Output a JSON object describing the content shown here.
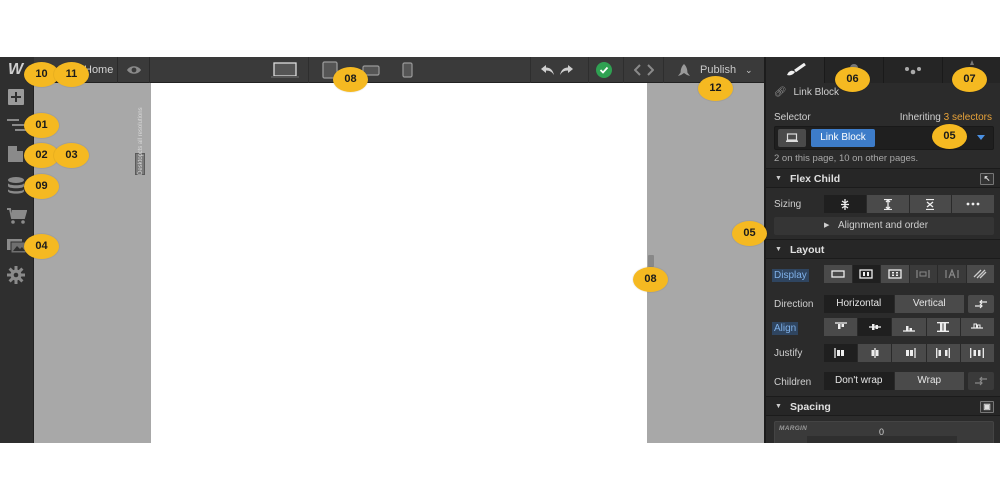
{
  "topbar": {
    "logo": "W",
    "page_name": "Home",
    "devices": [
      "desktop",
      "tablet",
      "mobile-landscape",
      "mobile-portrait"
    ],
    "active_device": "desktop",
    "publish_label": "Publish",
    "publish_chevron": "⌄"
  },
  "left_sidebar": {
    "items": [
      {
        "name": "add-elements",
        "icon": "plus-icon"
      },
      {
        "name": "navigator",
        "icon": "navigator-icon"
      },
      {
        "name": "pages",
        "icon": "pages-icon"
      },
      {
        "name": "cms",
        "icon": "database-icon"
      },
      {
        "name": "ecommerce",
        "icon": "cart-icon"
      },
      {
        "name": "assets",
        "icon": "images-icon"
      },
      {
        "name": "settings",
        "icon": "gear-icon"
      }
    ]
  },
  "canvas": {
    "breakpoint_note": "Affects all resolutions",
    "breakpoint_tag": "Desktop"
  },
  "panel": {
    "tabs": [
      "style",
      "settings",
      "interactions",
      "lightning"
    ],
    "element_name": "Link Block",
    "selector_label": "Selector",
    "inheriting_prefix": "Inheriting",
    "inheriting_count": "3 selectors",
    "selector_chip": "Link Block",
    "usage_text": "2 on this page, 10 on other pages.",
    "flex_child": {
      "title": "Flex Child",
      "sizing_label": "Sizing",
      "sizing_options": [
        "shrink",
        "grow",
        "none",
        "more"
      ],
      "alignment_order_label": "Alignment and order"
    },
    "layout": {
      "title": "Layout",
      "display_label": "Display",
      "display_options": [
        "block",
        "flex",
        "grid",
        "inline-block",
        "inline",
        "none"
      ],
      "direction_label": "Direction",
      "direction_options": [
        "Horizontal",
        "Vertical"
      ],
      "direction_selected": "Horizontal",
      "align_label": "Align",
      "align_options": [
        "start",
        "center",
        "end",
        "stretch",
        "baseline"
      ],
      "justify_label": "Justify",
      "justify_options": [
        "start",
        "center",
        "end",
        "space-between",
        "space-around"
      ],
      "children_label": "Children",
      "children_options": [
        "Don't wrap",
        "Wrap"
      ],
      "children_selected": "Don't wrap"
    },
    "spacing": {
      "title": "Spacing",
      "margin_label": "MARGIN",
      "margin_top": "0"
    }
  },
  "callouts": [
    "10",
    "11",
    "01",
    "02",
    "03",
    "09",
    "04",
    "08",
    "08",
    "12",
    "06",
    "07",
    "05",
    "05"
  ],
  "colors": {
    "accent_blue": "#3d7cc9",
    "highlight_orange": "#e8a33a",
    "callout_yellow": "#f5b921",
    "status_green": "#2fa152"
  }
}
